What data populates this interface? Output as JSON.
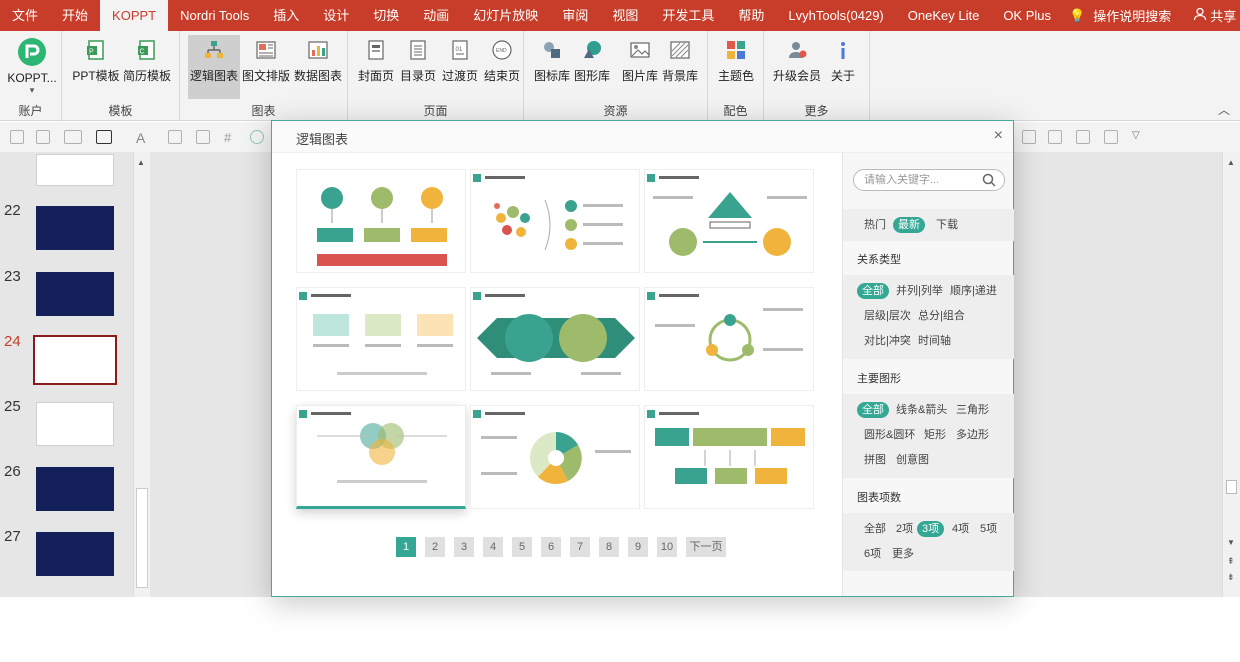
{
  "tabs": [
    "文件",
    "开始",
    "KOPPT",
    "Nordri Tools",
    "插入",
    "设计",
    "切换",
    "动画",
    "幻灯片放映",
    "审阅",
    "视图",
    "开发工具",
    "帮助",
    "LvyhTools(0429)",
    "OneKey Lite",
    "OK Plus"
  ],
  "active_tab": "KOPPT",
  "search_tab": "操作说明搜索",
  "share": "共享",
  "ribbon": {
    "account": {
      "btn": "KOPPT...",
      "label": "账户"
    },
    "templates": {
      "btn1": "PPT模板",
      "btn2": "简历模板",
      "label": "模板"
    },
    "charts": {
      "btn1": "逻辑图表",
      "btn2": "图文排版",
      "btn3": "数据图表",
      "label": "图表"
    },
    "pages": {
      "btn1": "封面页",
      "btn2": "目录页",
      "btn3": "过渡页",
      "btn4": "结束页",
      "label": "页面"
    },
    "resources": {
      "btn1": "图标库",
      "btn2": "图形库",
      "btn3": "图片库",
      "btn4": "背景库",
      "label": "资源"
    },
    "colors": {
      "btn1": "主题色",
      "label": "配色"
    },
    "more": {
      "btn1": "升级会员",
      "btn2": "关于",
      "label": "更多"
    }
  },
  "slides": {
    "numbers": [
      "22",
      "23",
      "24",
      "25",
      "26",
      "27"
    ],
    "current": "24"
  },
  "dialog": {
    "title": "逻辑图表",
    "close": "×",
    "pages": [
      "1",
      "2",
      "3",
      "4",
      "5",
      "6",
      "7",
      "8",
      "9",
      "10"
    ],
    "current_page": "1",
    "next": "下一页",
    "search_placeholder": "请输入关键字...",
    "sort": [
      "热门",
      "最新",
      "下载"
    ],
    "sort_active": "最新",
    "relation": {
      "title": "关系类型",
      "items": [
        "全部",
        "并列|列举",
        "顺序|递进",
        "层级|层次",
        "总分|组合",
        "对比|冲突",
        "时间轴"
      ]
    },
    "shape": {
      "title": "主要图形",
      "items": [
        "全部",
        "线条&箭头",
        "三角形",
        "圆形&圆环",
        "矩形",
        "多边形",
        "拼图",
        "创意图"
      ]
    },
    "count": {
      "title": "图表项数",
      "items": [
        "全部",
        "2项",
        "3项",
        "4项",
        "5项",
        "6项",
        "更多"
      ],
      "active": "3项"
    }
  },
  "colors": {
    "accent": "#34a894",
    "ribbon_red": "#c73d2a",
    "teal": "#3aa38f",
    "green": "#9dbb6b",
    "yellow": "#f0b43c",
    "red": "#d9534f"
  }
}
